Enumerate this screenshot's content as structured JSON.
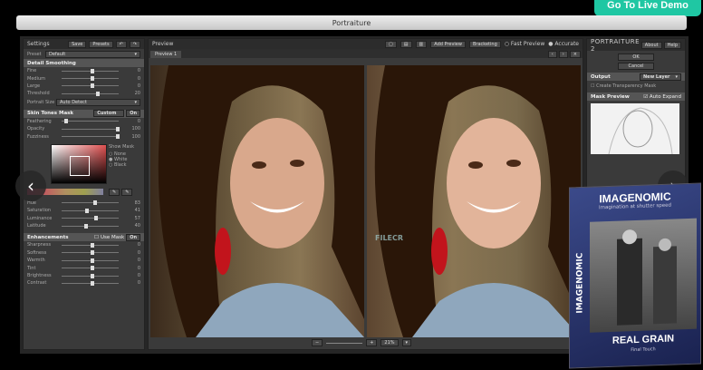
{
  "live_demo": "Go To Live Demo",
  "window_title": "Portraiture",
  "settings": {
    "title": "Settings",
    "save": "Save",
    "presets": "Presets",
    "preset_label": "Preset",
    "preset_value": "Default",
    "detail_smoothing": "Detail Smoothing",
    "detail_rows": [
      {
        "label": "Fine",
        "value": "0",
        "level": 0.5
      },
      {
        "label": "Medium",
        "value": "0",
        "level": 0.5
      },
      {
        "label": "Large",
        "value": "0",
        "level": 0.5
      },
      {
        "label": "Threshold",
        "value": "20",
        "level": 0.6
      }
    ],
    "portrait_size_label": "Portrait Size",
    "portrait_size_value": "Auto Detect",
    "skin_tones_mask": "Skin Tones Mask",
    "custom": "Custom",
    "on": "On",
    "mask_rows": [
      {
        "label": "Feathering",
        "value": "0",
        "level": 0.05
      },
      {
        "label": "Opacity",
        "value": "100",
        "level": 0.95
      },
      {
        "label": "Fuzziness",
        "value": "100",
        "level": 0.95
      }
    ],
    "show_mask": "Show Mask",
    "radio_none": "None",
    "radio_white": "White",
    "radio_black": "Black",
    "color_rows": [
      {
        "label": "Hue",
        "value": "83",
        "level": 0.55
      },
      {
        "label": "Saturation",
        "value": "41",
        "level": 0.42
      },
      {
        "label": "Luminance",
        "value": "57",
        "level": 0.57
      },
      {
        "label": "Latitude",
        "value": "40",
        "level": 0.4
      }
    ],
    "enhancements": "Enhancements",
    "use_mask": "Use Mask",
    "on2": "On",
    "enh_rows": [
      {
        "label": "Sharpness",
        "value": "0",
        "level": 0.5
      },
      {
        "label": "Softness",
        "value": "0",
        "level": 0.5
      },
      {
        "label": "Warmth",
        "value": "0",
        "level": 0.5
      },
      {
        "label": "Tint",
        "value": "0",
        "level": 0.5
      },
      {
        "label": "Brightness",
        "value": "0",
        "level": 0.5
      },
      {
        "label": "Contrast",
        "value": "0",
        "level": 0.5
      }
    ]
  },
  "preview": {
    "title": "Preview",
    "add_preview": "Add Preview",
    "bracketing": "Bracketing",
    "fast_preview": "Fast Preview",
    "accurate": "Accurate",
    "tab": "Preview 1",
    "zoom": "21%"
  },
  "right": {
    "logo_a": "PORTRAIT",
    "logo_b": "URE 2",
    "about": "About",
    "help": "Help",
    "ok": "OK",
    "cancel": "Cancel",
    "output": "Output",
    "new_layer": "New Layer",
    "create_transparency": "Create Transparency Mask",
    "mask_preview": "Mask Preview",
    "auto_expand": "Auto Expand"
  },
  "watermark": "FILECR",
  "box": {
    "brand": "IMAGENOMIC",
    "tagline": "Imagination at shutter speed",
    "vertical": "IMAGENOMIC",
    "product": "REAL GRAIN",
    "sub": "Final Touch"
  }
}
